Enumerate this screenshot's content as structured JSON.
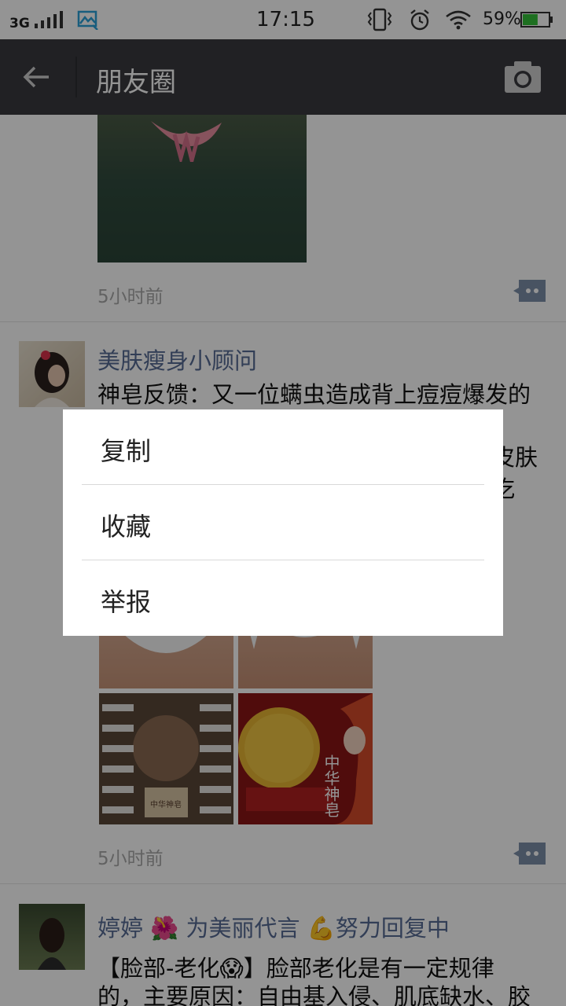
{
  "status_bar": {
    "network": "3G",
    "time": "17:15",
    "battery_percent": "59%",
    "battery_level": 0.59,
    "icons": [
      "signal-icon",
      "gallery-icon",
      "vibrate-icon",
      "alarm-icon",
      "wifi-icon",
      "battery-icon"
    ]
  },
  "app_bar": {
    "title": "朋友圈",
    "back_icon": "back-arrow-icon",
    "camera_icon": "camera-icon"
  },
  "posts": [
    {
      "time": "5小时前"
    },
    {
      "username": "美肤瘦身小顾问",
      "lines": [
        "神皂反馈：又一位螨虫造成背上痘痘爆发的",
        "皮肤",
        "吃"
      ],
      "time": "5小时前",
      "image_texts": {
        "tile3": "中华神皂",
        "tile4": "中华神皂"
      }
    },
    {
      "username": "婷婷 🌺 为美丽代言 💪努力回复中",
      "lines": [
        "【脸部-老化😱】脸部老化是有一定规律",
        "的，主要原因：自由基入侵、肌底缺水、胶"
      ]
    }
  ],
  "menu": {
    "items": [
      "复制",
      "收藏",
      "举报"
    ]
  },
  "colors": {
    "app_bar_bg": "#393a3f",
    "username": "#576b95",
    "battery_fill": "#35c13a",
    "overlay": "rgba(0,0,0,0.42)"
  }
}
